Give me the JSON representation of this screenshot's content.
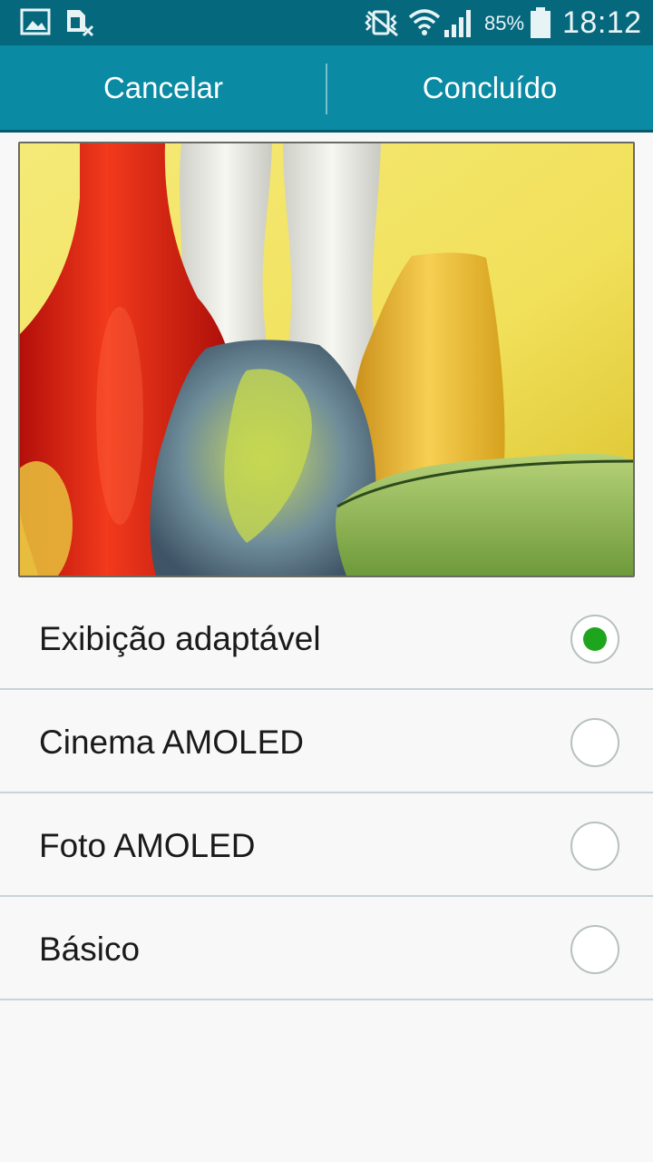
{
  "status_bar": {
    "battery_percent": "85%",
    "time": "18:12",
    "icons": [
      "gallery-icon",
      "sim-card-error-icon",
      "vibrate-mute-icon",
      "wifi-icon",
      "cellular-signal-icon",
      "battery-icon"
    ]
  },
  "action_bar": {
    "cancel_label": "Cancelar",
    "done_label": "Concluído"
  },
  "preview": {
    "icon": "glass-vases-preview-image"
  },
  "options": [
    {
      "label": "Exibição adaptável",
      "selected": true
    },
    {
      "label": "Cinema AMOLED",
      "selected": false
    },
    {
      "label": "Foto AMOLED",
      "selected": false
    },
    {
      "label": "Básico",
      "selected": false
    }
  ],
  "colors": {
    "status_bar": "#06687d",
    "action_bar": "#0a8aa3",
    "radio_selected": "#1ea51e",
    "background": "#f8f8f8"
  }
}
